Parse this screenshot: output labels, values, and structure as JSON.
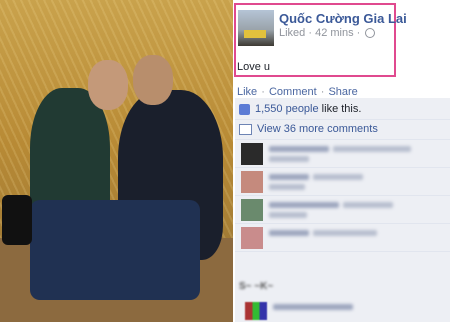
{
  "post": {
    "author": "Quốc Cường Gia Lai",
    "liked": "Liked",
    "dot": " · ",
    "time": "42 mins",
    "status": "Love u"
  },
  "actions": {
    "like": "Like",
    "comment": "Comment",
    "share": "Share",
    "sep": " · "
  },
  "feedback": {
    "likes_count": "1,550 people",
    "likes_suffix": " like this.",
    "view_comments": "View 36 more comments"
  },
  "colors": {
    "link": "#3b5998",
    "highlight_border": "#e04a8f",
    "feedback_bg": "#edeff4"
  }
}
